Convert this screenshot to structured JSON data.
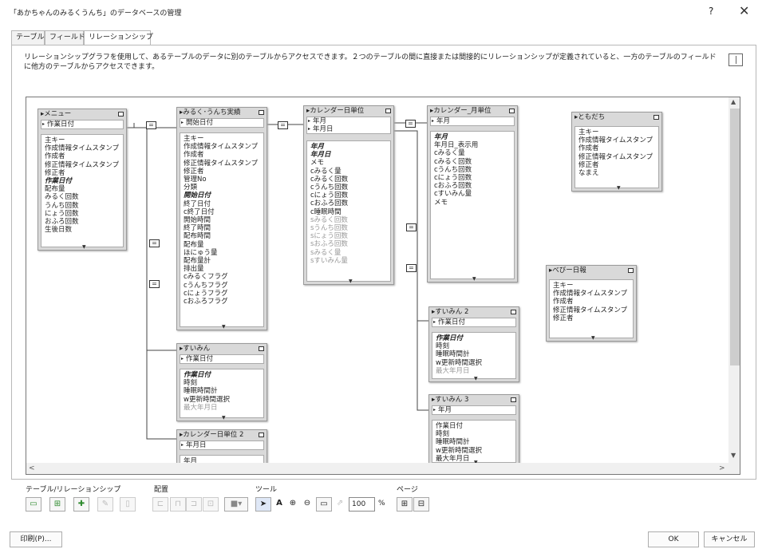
{
  "window": {
    "title": "「あかちゃんのみるくうんち」のデータベースの管理",
    "help": "?",
    "close": "✕"
  },
  "tabs": [
    "テーブル",
    "フィールド",
    "リレーションシップ"
  ],
  "description": "リレーションシップグラフを使用して、あるテーブルのデータに別のテーブルからアクセスできます。２つのテーブルの間に直接または間接的にリレーションシップが定義されていると、一方のテーブルのフィールドに他方のテーブルからアクセスできます。",
  "tables": [
    {
      "name": "メニュー",
      "keys": [
        "作業日付"
      ],
      "fields": [
        {
          "t": "主キー"
        },
        {
          "t": "作成情報タイムスタンプ"
        },
        {
          "t": "作成者"
        },
        {
          "t": "修正情報タイムスタンプ"
        },
        {
          "t": "修正者"
        },
        {
          "t": "作業日付",
          "s": "i"
        },
        {
          "t": "配布量"
        },
        {
          "t": "みるく回数"
        },
        {
          "t": "うんち回数"
        },
        {
          "t": "にょう回数"
        },
        {
          "t": "おふろ回数"
        },
        {
          "t": "生後日数"
        }
      ]
    },
    {
      "name": "みるく･うんち実績",
      "keys": [
        "開始日付"
      ],
      "fields": [
        {
          "t": "主キー"
        },
        {
          "t": "作成情報タイムスタンプ"
        },
        {
          "t": "作成者"
        },
        {
          "t": "修正情報タイムスタンプ"
        },
        {
          "t": "修正者"
        },
        {
          "t": "管理No"
        },
        {
          "t": "分類"
        },
        {
          "t": "開始日付",
          "s": "i"
        },
        {
          "t": "終了日付"
        },
        {
          "t": "c終了日付"
        },
        {
          "t": "開始時間"
        },
        {
          "t": "終了時間"
        },
        {
          "t": "配布時間"
        },
        {
          "t": "配布量"
        },
        {
          "t": "ほにゅう量"
        },
        {
          "t": "配布量計"
        },
        {
          "t": "排出量"
        },
        {
          "t": "cみるくフラグ"
        },
        {
          "t": "cうんちフラグ"
        },
        {
          "t": "cにょうフラグ"
        },
        {
          "t": "cおふろフラグ"
        }
      ]
    },
    {
      "name": "カレンダー日単位",
      "keys": [
        "年月",
        "年月日"
      ],
      "fields": [
        {
          "t": "年月",
          "s": "i"
        },
        {
          "t": "年月日",
          "s": "i"
        },
        {
          "t": "メモ"
        },
        {
          "t": "cみるく量"
        },
        {
          "t": "cみるく回数"
        },
        {
          "t": "cうんち回数"
        },
        {
          "t": "cにょう回数"
        },
        {
          "t": "cおふろ回数"
        },
        {
          "t": "c睡眠時間"
        },
        {
          "t": "sみるく回数",
          "s": "g"
        },
        {
          "t": "sうんち回数",
          "s": "g"
        },
        {
          "t": "sにょう回数",
          "s": "g"
        },
        {
          "t": "sおふろ回数",
          "s": "g"
        },
        {
          "t": "sみるく量",
          "s": "g"
        },
        {
          "t": "sすいみん量",
          "s": "g"
        }
      ]
    },
    {
      "name": "カレンダー_月単位",
      "keys": [
        "年月"
      ],
      "fields": [
        {
          "t": "年月",
          "s": "i"
        },
        {
          "t": "年月日_表示用"
        },
        {
          "t": "cみるく量"
        },
        {
          "t": "cみるく回数"
        },
        {
          "t": "cうんち回数"
        },
        {
          "t": "cにょう回数"
        },
        {
          "t": "cおふろ回数"
        },
        {
          "t": "cすいみん量"
        },
        {
          "t": "メモ"
        }
      ]
    },
    {
      "name": "ともだち",
      "keys": [],
      "fields": [
        {
          "t": "主キー"
        },
        {
          "t": "作成情報タイムスタンプ"
        },
        {
          "t": "作成者"
        },
        {
          "t": "修正情報タイムスタンプ"
        },
        {
          "t": "修正者"
        },
        {
          "t": "なまえ"
        }
      ]
    },
    {
      "name": "べびー日報",
      "keys": [],
      "fields": [
        {
          "t": "主キー"
        },
        {
          "t": "作成情報タイムスタンプ"
        },
        {
          "t": "作成者"
        },
        {
          "t": "修正情報タイムスタンプ"
        },
        {
          "t": "修正者"
        }
      ]
    },
    {
      "name": "すいみん",
      "keys": [
        "作業日付"
      ],
      "fields": [
        {
          "t": "作業日付",
          "s": "i"
        },
        {
          "t": "時刻"
        },
        {
          "t": "睡眠時間計"
        },
        {
          "t": "w更新時間選択"
        },
        {
          "t": "最大年月日",
          "s": "g"
        }
      ]
    },
    {
      "name": "すいみん 2",
      "keys": [
        "作業日付"
      ],
      "fields": [
        {
          "t": "作業日付",
          "s": "i"
        },
        {
          "t": "時刻"
        },
        {
          "t": "睡眠時間計"
        },
        {
          "t": "w更新時間選択"
        },
        {
          "t": "最大年月日",
          "s": "g"
        }
      ]
    },
    {
      "name": "すいみん 3",
      "keys": [
        "年月"
      ],
      "fields": [
        {
          "t": "作業日付"
        },
        {
          "t": "時刻"
        },
        {
          "t": "睡眠時間計"
        },
        {
          "t": "w更新時間選択"
        },
        {
          "t": "最大年月日"
        }
      ]
    },
    {
      "name": "カレンダー日単位 2",
      "keys": [
        "年月日"
      ],
      "fields": [
        {
          "t": "年月"
        }
      ]
    }
  ],
  "toolbar": {
    "groups": [
      "テーブル/リレーションシップ",
      "配置",
      "ツール",
      "ページ"
    ],
    "zoom": "100",
    "pct": "%"
  },
  "buttons": {
    "print": "印刷(P)...",
    "ok": "OK",
    "cancel": "キャンセル"
  },
  "colors": {
    "tableHeader": "#d9d9d9",
    "activeTab": "#ffffff",
    "addIcon": "#2e8b2e"
  }
}
